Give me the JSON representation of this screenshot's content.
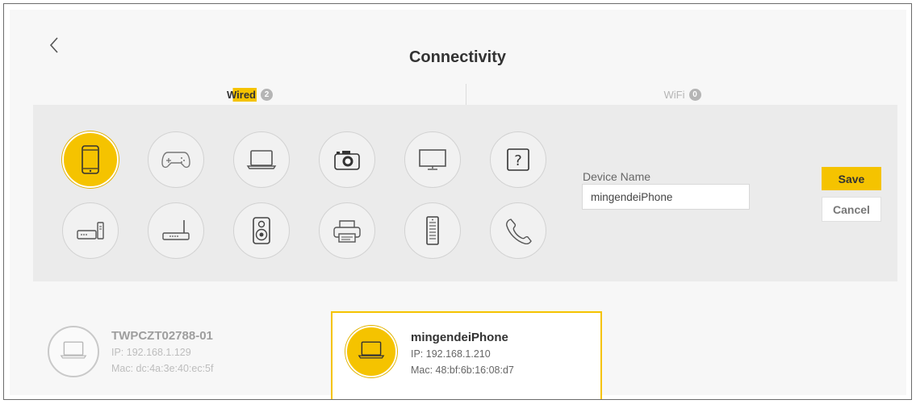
{
  "header": {
    "title": "Connectivity"
  },
  "tabs": {
    "wired": {
      "label": "Wired",
      "count": "2"
    },
    "wifi": {
      "label": "WiFi",
      "count": "0"
    }
  },
  "device_types": {
    "selected": "smartphone-icon",
    "row1": [
      "smartphone-icon",
      "gamepad-icon",
      "laptop-icon",
      "camera-icon",
      "monitor-icon",
      "question-mark-icon"
    ],
    "row2": [
      "modem-icon",
      "router-icon",
      "speaker-icon",
      "printer-icon",
      "server-icon",
      "phone-handset-icon"
    ]
  },
  "form": {
    "device_name_label": "Device Name",
    "device_name_value": "mingendeiPhone",
    "save_label": "Save",
    "cancel_label": "Cancel"
  },
  "devices": [
    {
      "name": "TWPCZT02788-01",
      "ip": "IP: 192.168.1.129",
      "mac": "Mac: dc:4a:3e:40:ec:5f",
      "icon": "laptop-icon",
      "selected": false
    },
    {
      "name": "mingendeiPhone",
      "ip": "IP: 192.168.1.210",
      "mac": "Mac: 48:bf:6b:16:08:d7",
      "icon": "laptop-icon",
      "selected": true
    }
  ],
  "colors": {
    "accent": "#f5c300",
    "panel": "#ebebeb",
    "text": "#333333",
    "muted": "#b5b5b5"
  }
}
